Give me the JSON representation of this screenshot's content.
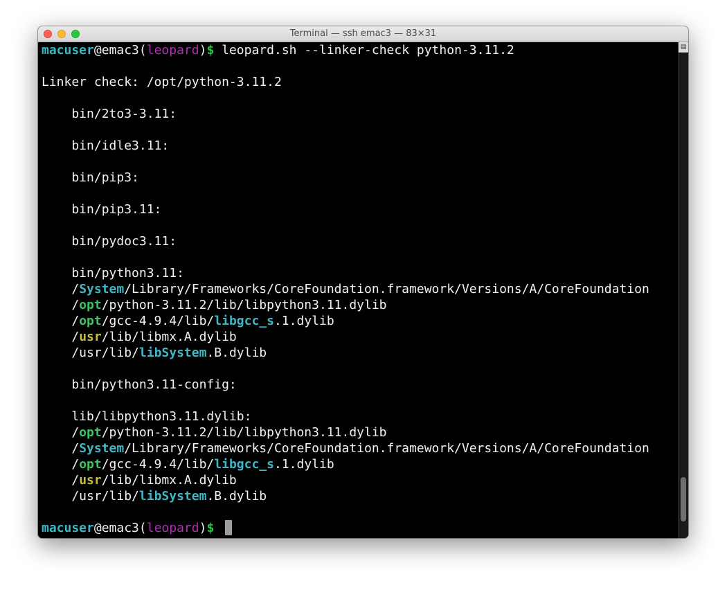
{
  "window": {
    "title": "Terminal — ssh emac3 — 83×31"
  },
  "prompt": {
    "user": "macuser",
    "at_host": "@emac3",
    "open_paren": "(",
    "env": "leopard",
    "close_paren": ")",
    "dollar": "$"
  },
  "command": " leopard.sh --linker-check python-3.11.2",
  "heading": "Linker check: /opt/python-3.11.2",
  "lines": {
    "l1": "    bin/2to3-3.11:",
    "l2": "    bin/idle3.11:",
    "l3": "    bin/pip3:",
    "l4": "    bin/pip3.11:",
    "l5": "    bin/pydoc3.11:",
    "l6": "    bin/python3.11:",
    "l7a": "    /",
    "l7b": "System",
    "l7c": "/Library/Frameworks/CoreFoundation.framework/Versions/A/CoreFoundation",
    "l8a": "    /",
    "l8b": "opt",
    "l8c": "/python-3.11.2/lib/libpython3.11.dylib",
    "l9a": "    /",
    "l9b": "opt",
    "l9c": "/gcc-4.9.4/lib/",
    "l9d": "libgcc_s",
    "l9e": ".1.dylib",
    "l10a": "    /",
    "l10b": "usr",
    "l10c": "/lib/libmx.A.dylib",
    "l11a": "    /usr/lib/",
    "l11b": "libSystem",
    "l11c": ".B.dylib",
    "l12": "    bin/python3.11-config:",
    "l13": "    lib/libpython3.11.dylib:",
    "l14a": "    /",
    "l14b": "opt",
    "l14c": "/python-3.11.2/lib/libpython3.11.dylib",
    "l15a": "    /",
    "l15b": "System",
    "l15c": "/Library/Frameworks/CoreFoundation.framework/Versions/A/CoreFoundation",
    "l16a": "    /",
    "l16b": "opt",
    "l16c": "/gcc-4.9.4/lib/",
    "l16d": "libgcc_s",
    "l16e": ".1.dylib",
    "l17a": "    /",
    "l17b": "usr",
    "l17c": "/lib/libmx.A.dylib",
    "l18a": "    /usr/lib/",
    "l18b": "libSystem",
    "l18c": ".B.dylib"
  },
  "colors": {
    "user": "#39b9c2",
    "env": "#b02fb3",
    "dollar": "#28c840",
    "system_dir": "#41b6c4",
    "opt_dir": "#3ec463",
    "usr_dir": "#c4bf3e"
  }
}
